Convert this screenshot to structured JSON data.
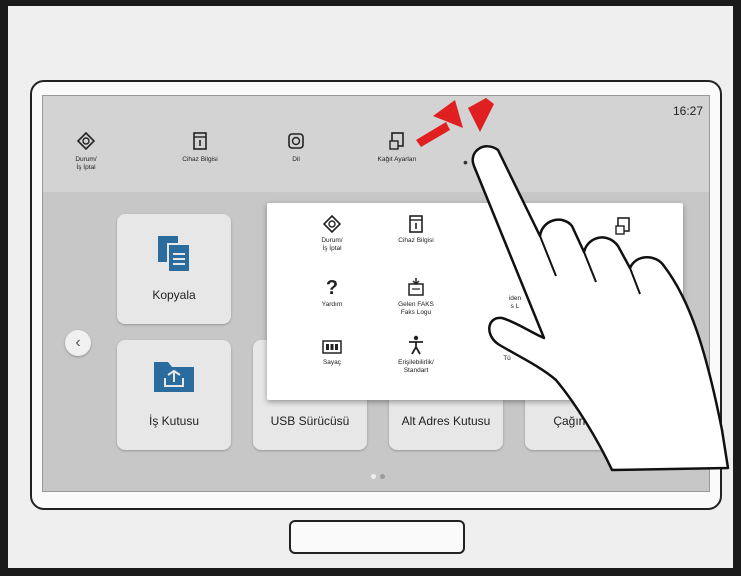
{
  "topbar": {
    "clock": "16:27",
    "items": [
      {
        "label_l1": "Durum/",
        "label_l2": "İş İptal",
        "icon": "status-icon"
      },
      {
        "label_l1": "Cihaz Bilgisi",
        "label_l2": "",
        "icon": "device-info-icon"
      },
      {
        "label_l1": "Dil",
        "label_l2": "",
        "icon": "language-icon"
      },
      {
        "label_l1": "Kağıt Ayarları",
        "label_l2": "",
        "icon": "paper-settings-icon"
      }
    ],
    "more": "• • •"
  },
  "tiles": [
    {
      "label": "Kopyala",
      "icon": "copy-icon"
    },
    {
      "label": "İş Kutusu",
      "icon": "job-box-icon"
    },
    {
      "label": "USB Sürücüsü",
      "icon": "usb-drive-icon"
    },
    {
      "label": "Alt Adres Kutusu",
      "icon": "subaddress-box-icon"
    },
    {
      "label": "Çağırma K",
      "icon": "polling-box-icon"
    }
  ],
  "popup": {
    "items": [
      {
        "label_l1": "Durum/",
        "label_l2": "İş İptal",
        "icon": "status-icon"
      },
      {
        "label_l1": "Cihaz Bilgisi",
        "label_l2": "",
        "icon": "device-info-icon"
      },
      {
        "label_l1": "Yardım",
        "label_l2": "",
        "icon": "help-icon"
      },
      {
        "label_l1": "Gelen FAKS",
        "label_l2": "Faks Logu",
        "icon": "fax-log-icon"
      },
      {
        "label_l1": "Sayaç",
        "label_l2": "",
        "icon": "counter-icon"
      },
      {
        "label_l1": "Erişilebilirlik/",
        "label_l2": "Standart",
        "icon": "accessibility-icon"
      },
      {
        "label_l1": "iden",
        "label_l2": "s L",
        "icon": "send-log-icon"
      },
      {
        "label_l1": "Tü",
        "label_l2": "",
        "icon": "toner-icon"
      }
    ]
  },
  "colors": {
    "accent": "#2b6c9e",
    "tap_marks": "#e02020"
  }
}
